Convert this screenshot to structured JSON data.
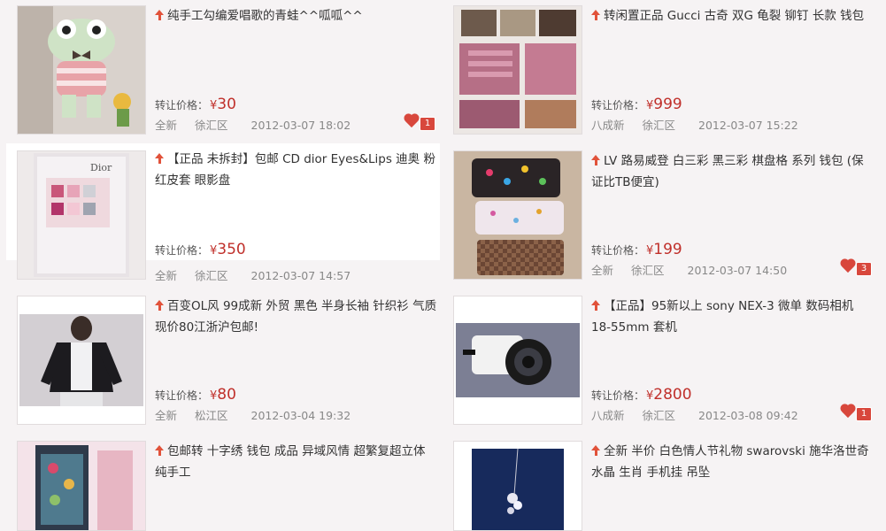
{
  "price_label": "转让价格：",
  "currency": "¥",
  "items": [
    {
      "title": "纯手工勾编爱唱歌的青蛙^^呱呱^^",
      "price": "30",
      "condition": "全新",
      "district": "徐汇区",
      "date": "2012-03-07 18:02",
      "likes": "1",
      "image": "crochet-frog-doll"
    },
    {
      "title": "转闲置正品 Gucci 古奇 双G 龟裂 铆钉 长款 钱包",
      "price": "999",
      "condition": "八成新",
      "district": "徐汇区",
      "date": "2012-03-07 15:22",
      "likes": "",
      "image": "pink-gucci-wallet"
    },
    {
      "title": "【正品 未拆封】包邮 CD dior Eyes&Lips 迪奥 粉红皮套 眼影盘",
      "price": "350",
      "condition": "全新",
      "district": "徐汇区",
      "date": "2012-03-07 14:57",
      "likes": "",
      "image": "dior-eyeshadow-palette"
    },
    {
      "title": "LV 路易威登 白三彩 黑三彩 棋盘格 系列 钱包 (保证比TB便宜)",
      "price": "199",
      "condition": "全新",
      "district": "徐汇区",
      "date": "2012-03-07 14:50",
      "likes": "3",
      "image": "lv-wallets"
    },
    {
      "title": "百变OL风 99成新 外贸 黑色 半身长袖 针织衫 气质 现价80江浙沪包邮!",
      "price": "80",
      "condition": "全新",
      "district": "松江区",
      "date": "2012-03-04 19:32",
      "likes": "",
      "image": "black-cardigan"
    },
    {
      "title": "【正品】95新以上 sony NEX-3 微单 数码相机 18-55mm 套机",
      "price": "2800",
      "condition": "八成新",
      "district": "徐汇区",
      "date": "2012-03-08 09:42",
      "likes": "1",
      "image": "sony-nex3-camera"
    },
    {
      "title": "包邮转 十字绣 钱包 成品 异域风情 超繁复超立体 纯手工",
      "price": "",
      "condition": "",
      "district": "",
      "date": "",
      "likes": "",
      "image": "cross-stitch-wallet"
    },
    {
      "title": "全新 半价 白色情人节礼物 swarovski 施华洛世奇 水晶 生肖 手机挂 吊坠",
      "price": "",
      "condition": "",
      "district": "",
      "date": "",
      "likes": "",
      "image": "swarovski-phone-charm"
    }
  ]
}
